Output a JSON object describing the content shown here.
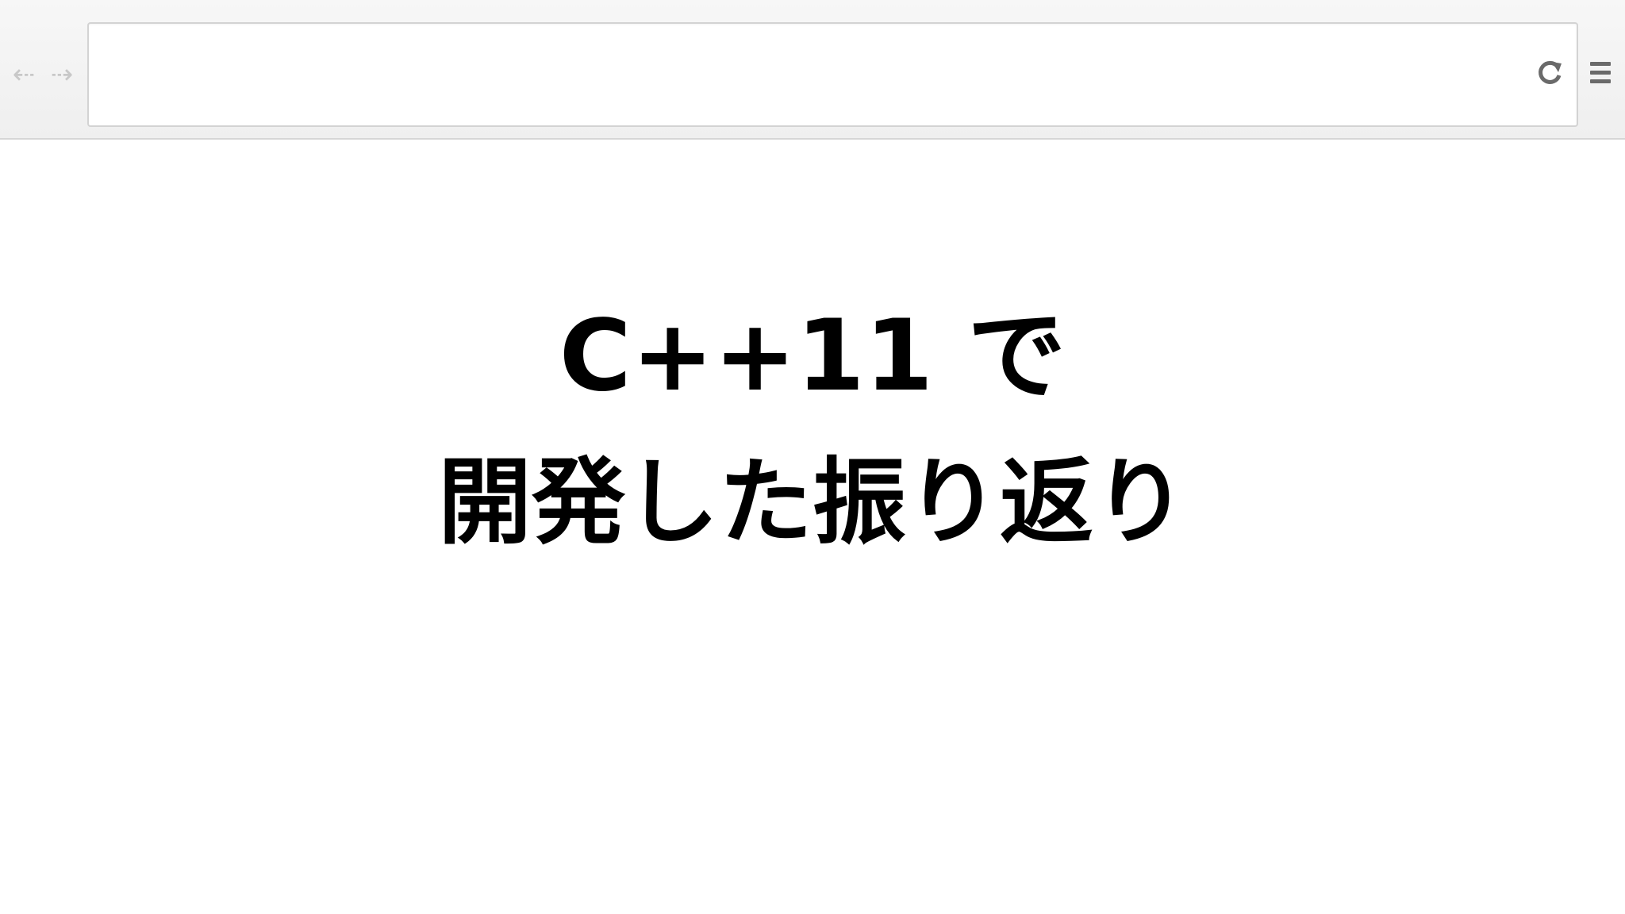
{
  "toolbar": {
    "back_icon": "arrow-left-icon",
    "forward_icon": "arrow-right-icon",
    "address_value": "",
    "reload_icon": "reload-icon",
    "menu_icon": "hamburger-menu-icon",
    "back_glyph": "⇠",
    "forward_glyph": "⇢"
  },
  "slide": {
    "title_line_1": "C++11 で",
    "title_line_2": "開発した振り返り"
  },
  "colors": {
    "toolbar_bg": "#f2f2f2",
    "icon_inactive": "#c8c8c8",
    "icon_active": "#6a6a6a",
    "text": "#000000"
  }
}
